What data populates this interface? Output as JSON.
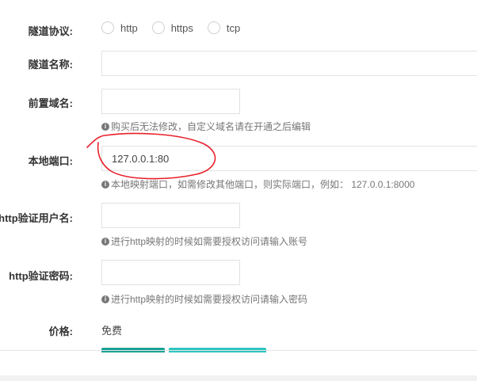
{
  "form": {
    "protocol": {
      "label": "隧道协议:",
      "options": [
        "http",
        "https",
        "tcp"
      ]
    },
    "tunnel_name": {
      "label": "隧道名称:",
      "value": ""
    },
    "prefix_domain": {
      "label": "前置域名:",
      "value": "",
      "hint": "购买后无法修改，自定义域名请在开通之后编辑"
    },
    "local_port": {
      "label": "本地端口:",
      "value": "127.0.0.1:80",
      "hint": "本地映射端口，如需修改其他端口，则实际端口，例如： 127.0.0.1:8000"
    },
    "http_user": {
      "label": "http验证用户名:",
      "value": "",
      "hint": "进行http映射的时候如需要授权访问请输入账号"
    },
    "http_password": {
      "label": "http验证密码:",
      "value": "",
      "hint": "进行http映射的时候如需要授权访问请输入密码"
    },
    "price": {
      "label": "价格:",
      "value": "免费"
    }
  },
  "icons": {
    "info": "info-circle-icon"
  },
  "colors": {
    "annotation": "#e8202a",
    "button_primary": "#1aa094",
    "button_secondary": "#2ec4c0",
    "border": "#e2e2e2"
  }
}
